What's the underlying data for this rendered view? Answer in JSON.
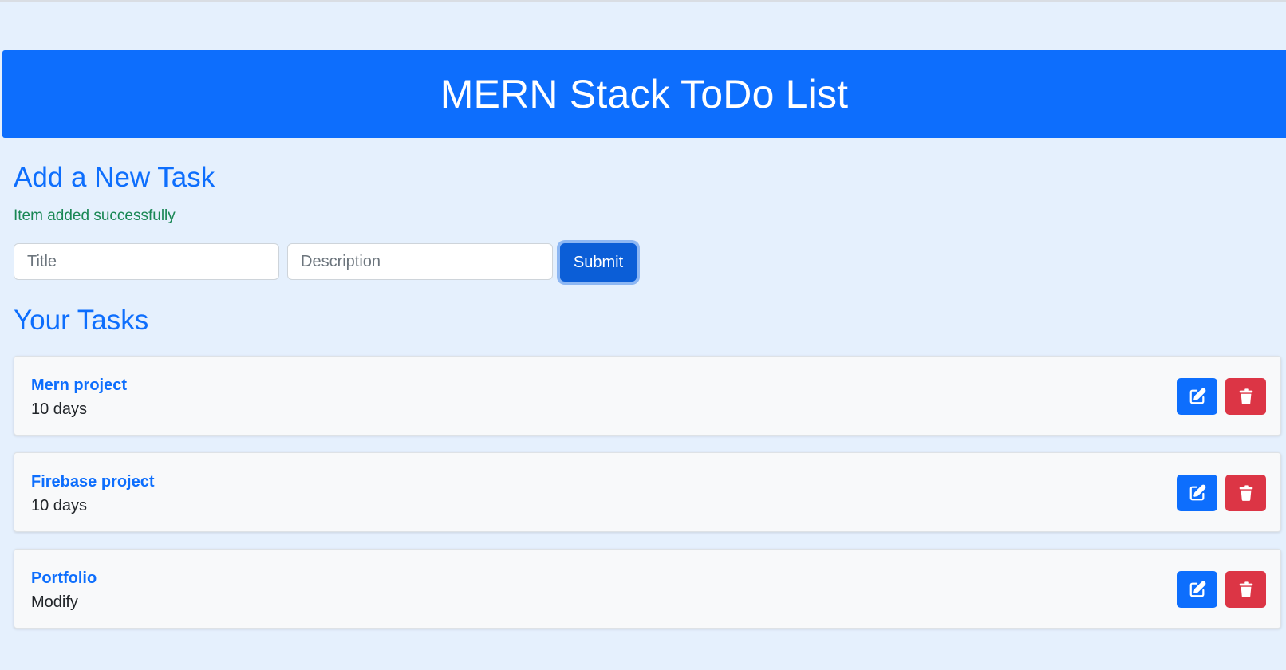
{
  "header": {
    "title": "MERN Stack ToDo List"
  },
  "add_section": {
    "heading": "Add a New Task",
    "success_message": "Item added successfully",
    "title_placeholder": "Title",
    "title_value": "",
    "description_placeholder": "Description",
    "description_value": "",
    "submit_label": "Submit"
  },
  "tasks_section": {
    "heading": "Your Tasks",
    "tasks": [
      {
        "title": "Mern project",
        "description": "10 days"
      },
      {
        "title": "Firebase project",
        "description": "10 days"
      },
      {
        "title": "Portfolio",
        "description": "Modify"
      }
    ]
  },
  "colors": {
    "primary": "#0d6efd",
    "danger": "#dc3545",
    "success": "#198754",
    "background": "#e5f0fd"
  },
  "icons": {
    "edit": "edit-icon",
    "delete": "trash-icon"
  }
}
